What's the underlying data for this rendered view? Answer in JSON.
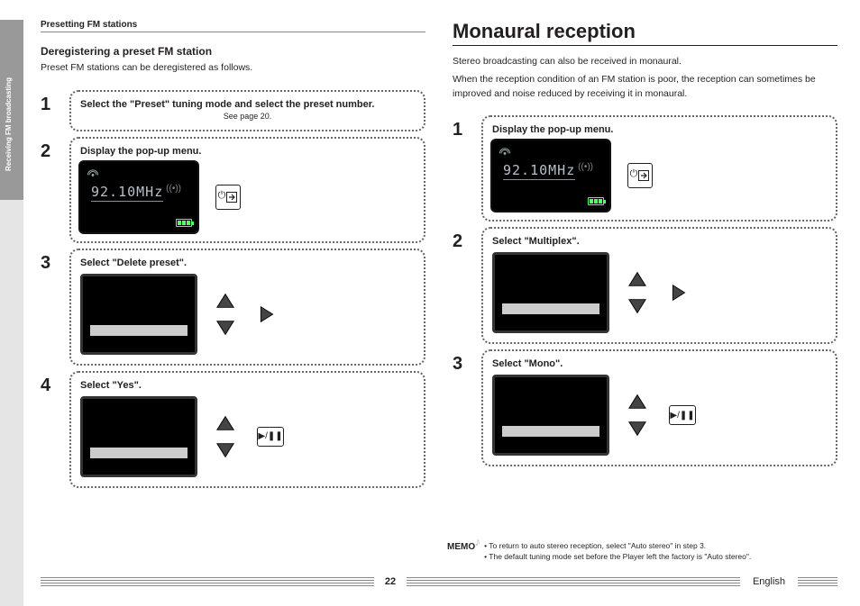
{
  "sidebar": {
    "section": "Receiving FM broadcasting"
  },
  "left": {
    "crumb": "Presetting FM stations",
    "subhead": "Deregistering a preset FM station",
    "intro": "Preset FM stations can be deregistered as follows.",
    "steps": [
      {
        "num": "1",
        "title": "Select the \"Preset\" tuning mode and select the preset number.",
        "sub": "See page 20."
      },
      {
        "num": "2",
        "title": "Display the pop-up menu."
      },
      {
        "num": "3",
        "title": "Select \"Delete preset\"."
      },
      {
        "num": "4",
        "title": "Select \"Yes\"."
      }
    ],
    "lcd_freq": "92.10MHz"
  },
  "right": {
    "heading": "Monaural reception",
    "para1": "Stereo broadcasting can also be received in monaural.",
    "para2": "When the reception condition of an FM station is poor, the reception can sometimes be improved and noise reduced by receiving it in monaural.",
    "steps": [
      {
        "num": "1",
        "title": "Display the pop-up menu."
      },
      {
        "num": "2",
        "title": "Select \"Multiplex\"."
      },
      {
        "num": "3",
        "title": "Select \"Mono\"."
      }
    ],
    "lcd_freq": "92.10MHz"
  },
  "memo": {
    "label": "MEMO",
    "lines": [
      "To return to auto stereo reception, select \"Auto stereo\" in step 3.",
      "The default tuning mode set before the Player left the factory is \"Auto stereo\"."
    ]
  },
  "footer": {
    "page": "22",
    "language": "English"
  },
  "icons": {
    "play_pause": "▶/❚❚"
  }
}
